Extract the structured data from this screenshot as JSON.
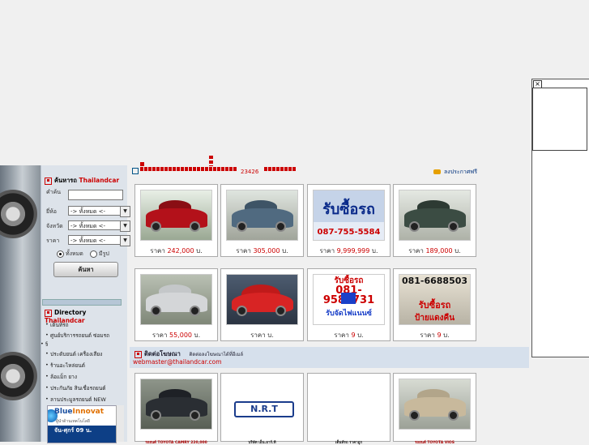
{
  "float_box": {
    "close_label": "×"
  },
  "sidebar": {
    "search": {
      "title": "ค้นหารถ",
      "brand": "Thailandcar",
      "label_keyword": "คำค้น",
      "label_brand": "ยี่ห้อ",
      "label_province": "จังหวัด",
      "label_price": "ราคา",
      "brand_select": "-> ทั้งหมด <-",
      "province_select": "-> ทั้งหมด <-",
      "price_select": "-> ทั้งหมด <-",
      "radio_all": "ทั้งหมด",
      "radio_photo": "มีรูป",
      "search_button": "ค้นหา"
    },
    "directory": {
      "title": "Directory",
      "brand": "Thailandcar",
      "items": [
        "เต็นท์รถ",
        "ศูนย์บริการรถยนต์ ซ่อมรถ",
        "§",
        "ประดับยนต์ เครื่องเสียง",
        "ร้านอะไหล่ยนต์",
        "ล้อแม็ก ยาง",
        "ประกันภัย สินเชื่อรถยนต์",
        "ลานประมูลรถยนต์ NEW"
      ]
    },
    "banner": {
      "logo_a": "Blue",
      "logo_b": "Innovat",
      "subtitle": "ผู้นำด้านเทคโนโลยี",
      "strip_text": "จัน-ศุกร์ 09 น."
    }
  },
  "header": {
    "counter": "23426",
    "post_link": "ลงประกาศฟรี"
  },
  "cards_row1": [
    {
      "label": "ราคา",
      "price": "242,000",
      "unit": "บ."
    },
    {
      "label": "ราคา",
      "price": "305,000",
      "unit": "บ."
    },
    {
      "label": "ราคา",
      "price": "9,999,999",
      "unit": "บ.",
      "ad_text": "รับซื้อรถ",
      "ad_phone": "087-755-5584"
    },
    {
      "label": "ราคา",
      "price": "189,000",
      "unit": "บ."
    }
  ],
  "cards_row2": [
    {
      "label": "ราคา",
      "price": "55,000",
      "unit": "บ."
    },
    {
      "label": "ราคา",
      "price": "",
      "unit": "บ."
    },
    {
      "label": "ราคา",
      "price": "9",
      "unit": "บ.",
      "ad_line1": "รับซื้อรถ",
      "ad_phone": "081-9582731",
      "ad_line2": "รับจัดไฟแนนซ์"
    },
    {
      "label": "ราคา",
      "price": "9",
      "unit": "บ.",
      "ad_phone": "081-6688503",
      "ad_line1": "รับซื้อรถ",
      "ad_line2": "ป้ายแดงคืน"
    }
  ],
  "contact": {
    "title": "ติดต่อโฆษณา",
    "subtitle": "ติดต่อลงโฆษณาได้ที่อีเมล์",
    "email": "webmaster@thailandcar.com"
  },
  "cards_row3": [
    {
      "caption": "รถยนต์ TOYOTA CAMRY 220,000"
    },
    {
      "logo": "N.R.T",
      "caption": "บริษัท เอ็น.อาร์.ที"
    },
    {
      "caption": "เต็นท์รถ ราคาถูก"
    },
    {
      "caption": "รถยนต์ TOYOTA VIOS"
    }
  ],
  "colors": {
    "accent_red": "#cc0000",
    "link_blue": "#00317c",
    "panel_bg": "#dde3ea"
  }
}
